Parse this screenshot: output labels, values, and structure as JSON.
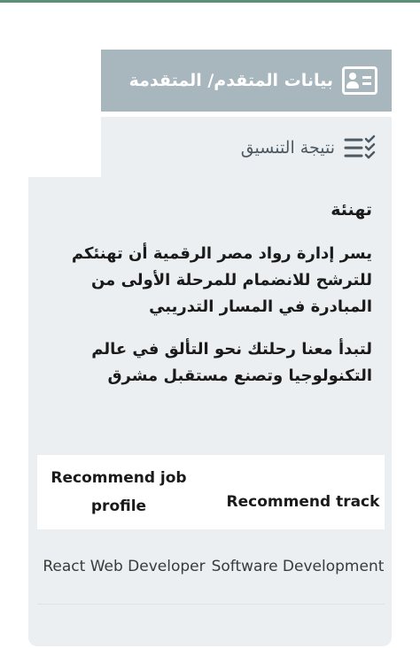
{
  "tabs": {
    "applicant_data": {
      "label": "بيانات المتقدم/ المتقدمة",
      "icon": "id-card-icon"
    },
    "coordination_result": {
      "label": "نتيجة التنسيق",
      "icon": "checklist-icon"
    }
  },
  "result": {
    "congrats": "تهنئة",
    "paragraph_1": "يسر إدارة رواد مصر الرقمية أن تهنئكم للترشح للانضمام للمرحلة الأولى من المبادرة في المسار التدريبي",
    "paragraph_2": "لتبدأ معنا رحلتك نحو التألق في عالم التكنولوجيا وتصنع مستقبل مشرق"
  },
  "recommendation": {
    "headers": {
      "job_profile": "Recommend job profile",
      "track": "Recommend track"
    },
    "rows": [
      {
        "job_profile": "React Web Developer",
        "track": "Software Development"
      }
    ]
  },
  "colors": {
    "accent_bar": "#5a8f78",
    "active_tab": "#a8b6bd",
    "panel_bg": "#eceff1"
  }
}
